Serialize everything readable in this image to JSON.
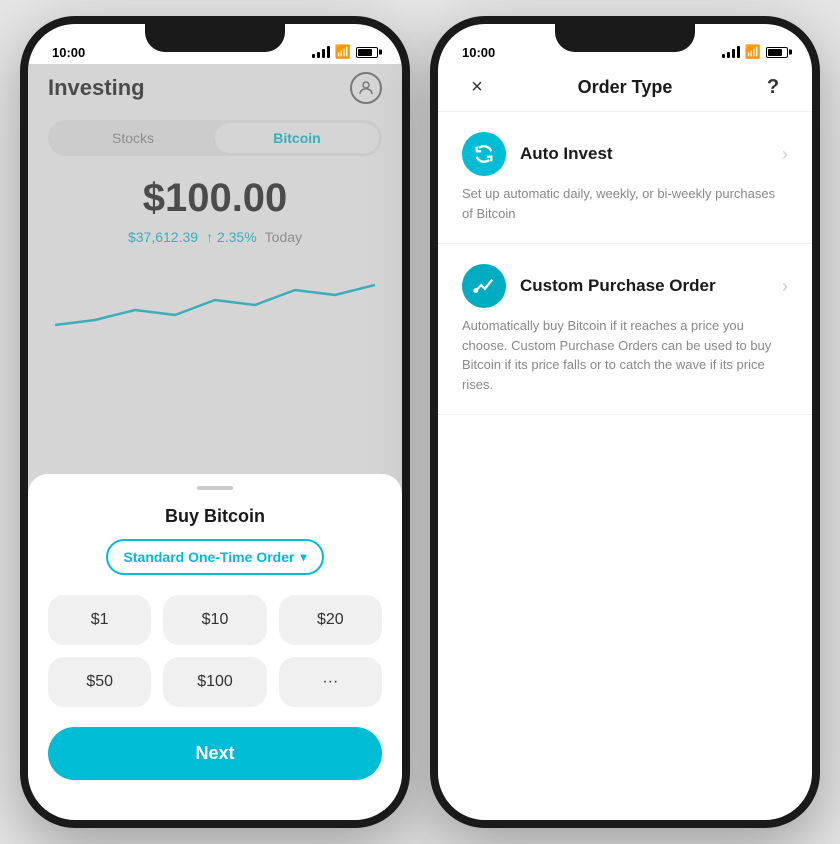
{
  "left_phone": {
    "status_time": "10:00",
    "header": {
      "title": "Investing"
    },
    "tabs": [
      {
        "label": "Stocks",
        "active": false
      },
      {
        "label": "Bitcoin",
        "active": true
      }
    ],
    "balance": {
      "amount": "$100.00",
      "price": "$37,612.39",
      "change": "↑ 2.35%",
      "period": "Today"
    },
    "bottom_sheet": {
      "title": "Buy Bitcoin",
      "order_type": "Standard One-Time Order",
      "amounts": [
        "$1",
        "$10",
        "$20",
        "$50",
        "$100",
        "···"
      ],
      "next_label": "Next"
    }
  },
  "right_phone": {
    "status_time": "10:00",
    "header": {
      "close": "×",
      "title": "Order Type",
      "help": "?"
    },
    "options": [
      {
        "icon": "↻",
        "label": "Auto Invest",
        "description": "Set up automatic daily, weekly, or bi-weekly purchases of Bitcoin"
      },
      {
        "icon": "⤢",
        "label": "Custom Purchase Order",
        "description": "Automatically buy Bitcoin if it reaches a price you choose. Custom Purchase Orders can be used to buy Bitcoin if its price falls or to catch the wave if its price rises."
      }
    ]
  }
}
